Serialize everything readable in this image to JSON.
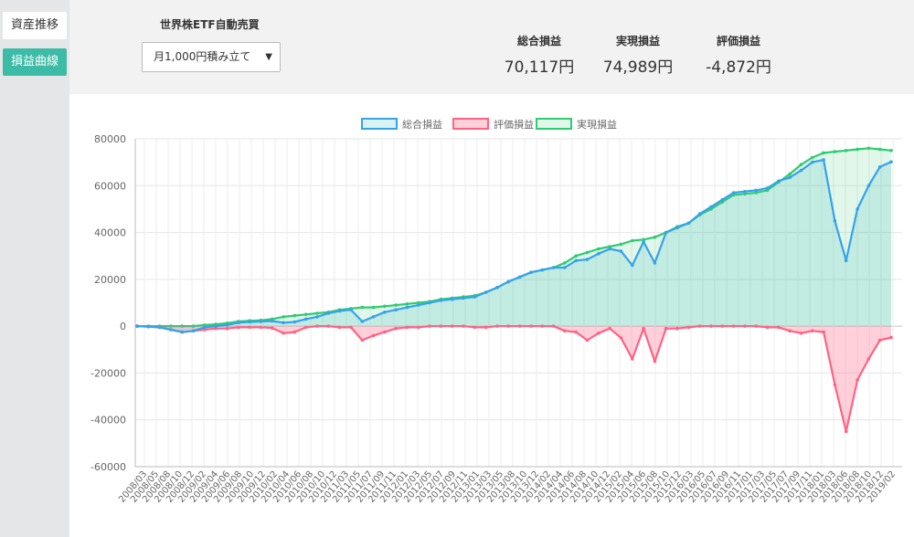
{
  "sidebar": {
    "items": [
      {
        "label": "資産推移",
        "active": false
      },
      {
        "label": "損益曲線",
        "active": true
      }
    ],
    "accent_color": "#3cbba6"
  },
  "header": {
    "strategy_title": "世界株ETF自動売買",
    "select": {
      "value": "月1,000円積み立て"
    },
    "stats": [
      {
        "label": "総合損益",
        "value": "70,117円"
      },
      {
        "label": "実現損益",
        "value": "74,989円"
      },
      {
        "label": "評価損益",
        "value": "-4,872円"
      }
    ]
  },
  "chart_data": {
    "type": "line",
    "legend": {
      "position": "top"
    },
    "grid": true,
    "ylim": [
      -60000,
      80000
    ],
    "yticks": [
      "80000",
      "60000",
      "40000",
      "20000",
      "0",
      "-20000",
      "-40000",
      "-60000"
    ],
    "categories": [
      "2008/03",
      "2008/05",
      "2008/08",
      "2008/10",
      "2008/12",
      "2009/02",
      "2009/04",
      "2009/06",
      "2009/08",
      "2009/10",
      "2009/12",
      "2010/02",
      "2010/04",
      "2010/06",
      "2010/08",
      "2010/10",
      "2010/12",
      "2011/03",
      "2011/05",
      "2011/07",
      "2011/09",
      "2011/11",
      "2012/01",
      "2012/03",
      "2012/05",
      "2012/07",
      "2012/09",
      "2012/11",
      "2013/01",
      "2013/03",
      "2013/05",
      "2013/08",
      "2013/10",
      "2013/12",
      "2014/02",
      "2014/04",
      "2014/06",
      "2014/08",
      "2014/10",
      "2014/12",
      "2015/02",
      "2015/04",
      "2015/06",
      "2015/08",
      "2015/10",
      "2015/12",
      "2016/03",
      "2016/05",
      "2016/07",
      "2016/09",
      "2016/11",
      "2017/01",
      "2017/03",
      "2017/05",
      "2017/07",
      "2017/09",
      "2017/11",
      "2018/01",
      "2018/03",
      "2018/06",
      "2018/08",
      "2018/10",
      "2018/12",
      "2019/02"
    ],
    "series": [
      {
        "name": "総合損益",
        "color": "#36a2eb",
        "fill": "rgba(75,192,192,0.2)",
        "values": [
          0,
          -200,
          -500,
          -1500,
          -2500,
          -2000,
          -500,
          0,
          500,
          1500,
          1800,
          2000,
          2200,
          1500,
          1800,
          3000,
          4000,
          5500,
          6500,
          7000,
          2000,
          4000,
          6000,
          7000,
          8000,
          9000,
          10000,
          11000,
          11500,
          12000,
          12500,
          14500,
          16500,
          19000,
          21000,
          23000,
          24000,
          25000,
          25000,
          28000,
          28500,
          31000,
          33000,
          32000,
          26000,
          36000,
          27000,
          40000,
          42000,
          44000,
          48000,
          51000,
          54000,
          57000,
          57500,
          58000,
          59000,
          62000,
          63500,
          66500,
          70000,
          71000,
          45000,
          28000,
          50000,
          60000,
          68000,
          70117
        ]
      },
      {
        "name": "評価損益",
        "color": "#ff6384",
        "fill": "rgba(255,99,132,0.3)",
        "values": [
          0,
          -200,
          -500,
          -1500,
          -2500,
          -2000,
          -1500,
          -1000,
          -1000,
          -500,
          -500,
          -500,
          -800,
          -3000,
          -2500,
          -500,
          0,
          0,
          -500,
          -500,
          -6000,
          -4000,
          -2500,
          -1000,
          -500,
          -500,
          0,
          0,
          0,
          0,
          -500,
          -500,
          0,
          0,
          0,
          0,
          0,
          0,
          -2000,
          -2500,
          -6000,
          -3000,
          -1000,
          -5000,
          -14000,
          -1000,
          -15000,
          -1000,
          -1000,
          -500,
          0,
          0,
          0,
          0,
          0,
          0,
          -500,
          -500,
          -2000,
          -3000,
          -2000,
          -2500,
          -25000,
          -45000,
          -23000,
          -14000,
          -6000,
          -4872
        ]
      },
      {
        "name": "実現損益",
        "color": "#2ecc71",
        "fill": "rgba(46,204,113,0.15)",
        "values": [
          0,
          0,
          0,
          0,
          0,
          0,
          500,
          800,
          1300,
          2000,
          2300,
          2500,
          3000,
          4000,
          4500,
          5000,
          5500,
          6000,
          7000,
          7500,
          8000,
          8000,
          8500,
          9000,
          9500,
          10000,
          10500,
          11500,
          12000,
          12500,
          13000,
          14500,
          16500,
          19000,
          21000,
          23000,
          24000,
          25000,
          27000,
          30000,
          31500,
          33000,
          34000,
          35000,
          36500,
          37000,
          38000,
          40000,
          42500,
          44000,
          47500,
          50000,
          53000,
          56000,
          56500,
          57000,
          58000,
          61500,
          65000,
          69000,
          72000,
          74000,
          74500,
          75000,
          75500,
          76000,
          75500,
          74989
        ]
      }
    ]
  }
}
